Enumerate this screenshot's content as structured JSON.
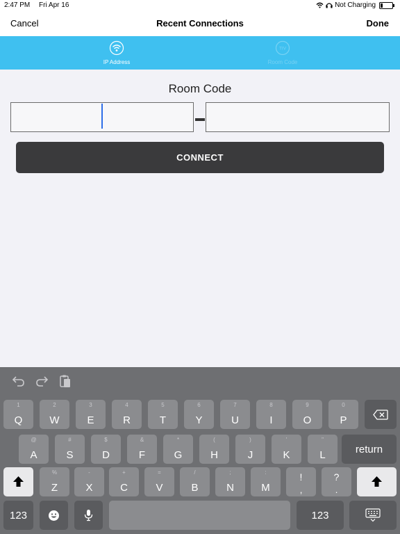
{
  "status_bar": {
    "time": "2:47 PM",
    "date": "Fri Apr 16",
    "charging": "Not Charging"
  },
  "nav": {
    "cancel": "Cancel",
    "title": "Recent Connections",
    "done": "Done"
  },
  "tabs": [
    {
      "label": "IP Address",
      "icon": "wifi-icon",
      "active": true
    },
    {
      "label": "Room Code",
      "icon": "tiv-icon",
      "active": false,
      "icon_text": "TIV"
    }
  ],
  "room_code": {
    "title": "Room Code",
    "first_value": "",
    "second_value": ""
  },
  "connect_label": "CONNECT",
  "keyboard": {
    "toolbar": [
      "undo-icon",
      "redo-icon",
      "paste-icon"
    ],
    "row1": [
      {
        "hint": "1",
        "main": "Q"
      },
      {
        "hint": "2",
        "main": "W"
      },
      {
        "hint": "3",
        "main": "E"
      },
      {
        "hint": "4",
        "main": "R"
      },
      {
        "hint": "5",
        "main": "T"
      },
      {
        "hint": "6",
        "main": "Y"
      },
      {
        "hint": "7",
        "main": "U"
      },
      {
        "hint": "8",
        "main": "I"
      },
      {
        "hint": "9",
        "main": "O"
      },
      {
        "hint": "0",
        "main": "P"
      }
    ],
    "row2": [
      {
        "hint": "@",
        "main": "A"
      },
      {
        "hint": "#",
        "main": "S"
      },
      {
        "hint": "$",
        "main": "D"
      },
      {
        "hint": "&",
        "main": "F"
      },
      {
        "hint": "*",
        "main": "G"
      },
      {
        "hint": "(",
        "main": "H"
      },
      {
        "hint": ")",
        "main": "J"
      },
      {
        "hint": "'",
        "main": "K"
      },
      {
        "hint": "\"",
        "main": "L"
      }
    ],
    "row3": [
      {
        "hint": "%",
        "main": "Z"
      },
      {
        "hint": "-",
        "main": "X"
      },
      {
        "hint": "+",
        "main": "C"
      },
      {
        "hint": "=",
        "main": "V"
      },
      {
        "hint": "/",
        "main": "B"
      },
      {
        "hint": ";",
        "main": "N"
      },
      {
        "hint": ":",
        "main": "M"
      }
    ],
    "punct": [
      {
        "hint": "!",
        "main": ","
      },
      {
        "hint": "?",
        "main": "."
      }
    ],
    "return_label": "return",
    "numbers_label": "123",
    "emoji_icon": "emoji-icon",
    "mic_icon": "microphone-icon"
  },
  "colors": {
    "tab_bar": "#3fc0f0",
    "connect_button": "#3a3a3c",
    "keyboard": "#6e6f72",
    "cursor": "#2f6ee8"
  }
}
